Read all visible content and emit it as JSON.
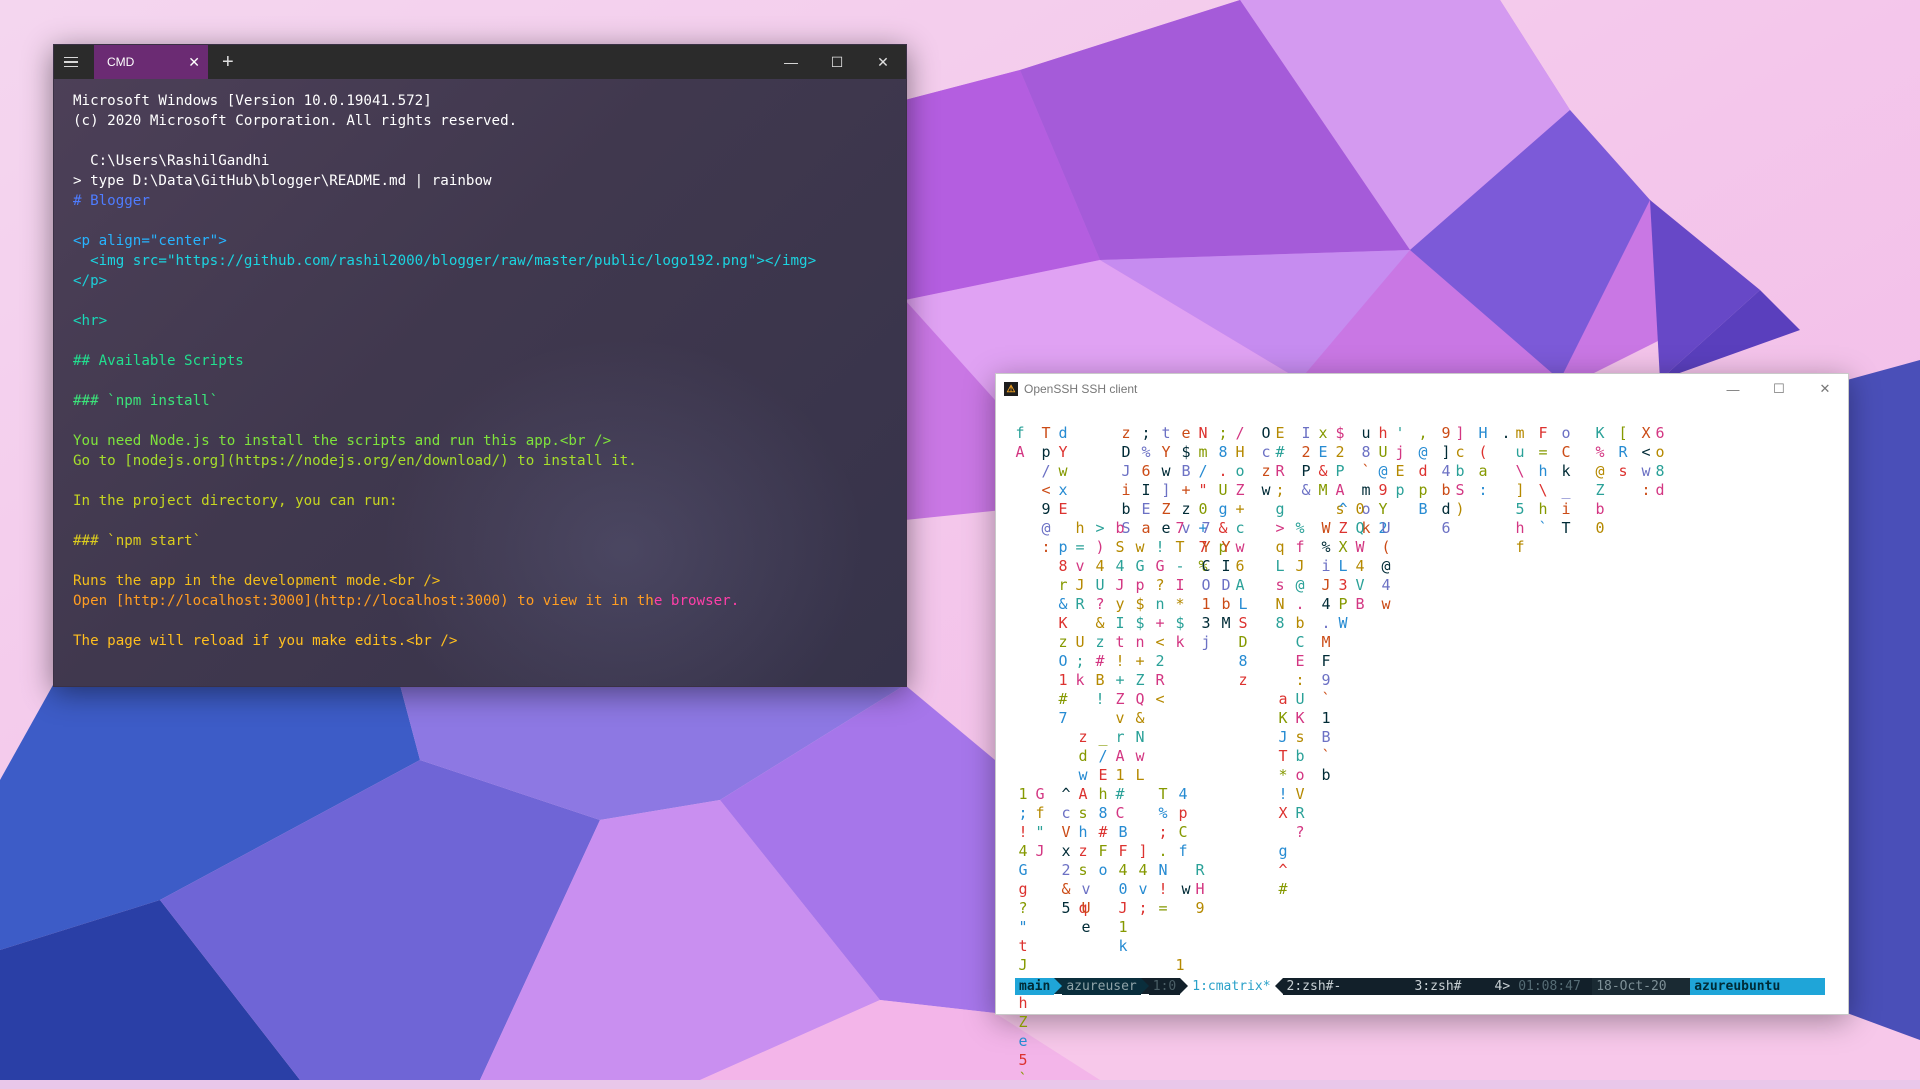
{
  "cmd_window": {
    "tab_title": "CMD",
    "tab_close": "✕",
    "new_tab": "+",
    "menu_icon": "hamburger-icon",
    "controls": {
      "minimize": "—",
      "maximize": "☐",
      "close": "✕"
    },
    "lines": [
      {
        "text": "Microsoft Windows [Version 10.0.19041.572]",
        "color": "#ffffff"
      },
      {
        "text": "(c) 2020 Microsoft Corporation. All rights reserved.",
        "color": "#ffffff"
      },
      {
        "text": "",
        "color": "#ffffff"
      },
      {
        "text": "  C:\\Users\\RashilGandhi",
        "color": "#ffffff"
      },
      {
        "text": "> type D:\\Data\\GitHub\\blogger\\README.md | rainbow",
        "color": "#ffffff"
      },
      {
        "text": "# Blogger",
        "color": "#4e7cff"
      },
      {
        "text": "",
        "color": "#ffffff"
      },
      {
        "text": "<p align=\"center\">",
        "color": "#27b4ff"
      },
      {
        "text": "  <img src=\"https://github.com/rashil2000/blogger/raw/master/public/logo192.png\"></img>",
        "color": "#1cd4e0"
      },
      {
        "text": "</p>",
        "color": "#1ccfd8"
      },
      {
        "text": "",
        "color": "#ffffff"
      },
      {
        "text": "<hr>",
        "color": "#19d8b8"
      },
      {
        "text": "",
        "color": "#ffffff"
      },
      {
        "text": "## Available Scripts",
        "color": "#22df8f"
      },
      {
        "text": "",
        "color": "#ffffff"
      },
      {
        "text": "### `npm install`",
        "color": "#3be47a"
      },
      {
        "text": "",
        "color": "#ffffff"
      },
      {
        "text": "You need Node.js to install the scripts and run this app.<br />",
        "color": "#7fe33c"
      },
      {
        "text": "Go to [nodejs.org](https://nodejs.org/en/download/) to install it.",
        "color": "#a6df2c"
      },
      {
        "text": "",
        "color": "#ffffff"
      },
      {
        "text": "In the project directory, you can run:",
        "color": "#c6d620"
      },
      {
        "text": "",
        "color": "#ffffff"
      },
      {
        "text": "### `npm start`",
        "color": "#dccd1e"
      },
      {
        "text": "",
        "color": "#ffffff"
      },
      {
        "text": "Runs the app in the development mode.<br />",
        "color": "#f2bd1c"
      },
      {
        "text": "Open [http://localhost:3000](http://localhost:3000) to view it in th",
        "color": "#ff9d22",
        "tail": "e browser.",
        "tail_color": "#ff3fa8"
      },
      {
        "text": "",
        "color": "#ffffff"
      },
      {
        "text": "The page will reload if you make edits.<br />",
        "color": "#ffbf1f"
      }
    ]
  },
  "ssh_window": {
    "title": "OpenSSH SSH client",
    "app_icon": "ssh-app-icon",
    "controls": {
      "minimize": "—",
      "maximize": "☐",
      "close": "✕"
    },
    "matrix_colors": [
      "#2aa198",
      "#268bd2",
      "#6c71c4",
      "#d33682",
      "#dc322f",
      "#cb4b16",
      "#b58900",
      "#859900",
      "#002b36"
    ],
    "matrix_columns": [
      {
        "col": 0,
        "start": 0,
        "chars": "fA"
      },
      {
        "col": 0,
        "start": 19,
        "chars": "1;!4Gg?\"tJ0hZe5`"
      },
      {
        "col": 1,
        "start": 0,
        "chars": "Tp/<9@:"
      },
      {
        "col": 1,
        "start": 19,
        "chars": "Gf\"J"
      },
      {
        "col": 2,
        "start": 0,
        "chars": "dYwxE p8r&KzO1#7"
      },
      {
        "col": 2,
        "start": 19,
        "chars": "^cVx2&5"
      },
      {
        "col": 3,
        "start": 5,
        "chars": "h=vJR U;k"
      },
      {
        "col": 3,
        "start": 16,
        "chars": "zdwAshzs q"
      },
      {
        "col": 3,
        "start": 24,
        "chars": "vUe"
      },
      {
        "col": 4,
        "start": 5,
        "chars": ">)4U?&z#B!"
      },
      {
        "col": 4,
        "start": 16,
        "chars": "_/Eh8#Fo"
      },
      {
        "col": 5,
        "start": 0,
        "chars": "zDJibS"
      },
      {
        "col": 5,
        "start": 5,
        "chars": "bS4JyIt!+ZvrA1#C"
      },
      {
        "col": 5,
        "start": 21,
        "chars": "BF40J1k"
      },
      {
        "col": 6,
        "start": 0,
        "chars": ";%6IEa"
      },
      {
        "col": 6,
        "start": 6,
        "chars": "wGp$$n+ZQ&NwL"
      },
      {
        "col": 6,
        "start": 22,
        "chars": "]4v;"
      },
      {
        "col": 7,
        "start": 0,
        "chars": "tYw]Ze"
      },
      {
        "col": 7,
        "start": 6,
        "chars": "!G?n+<2R<"
      },
      {
        "col": 7,
        "start": 19,
        "chars": "T%;.N!="
      },
      {
        "col": 8,
        "start": 0,
        "chars": "e$B+zv"
      },
      {
        "col": 8,
        "start": 5,
        "chars": "7T-I*$k"
      },
      {
        "col": 8,
        "start": 19,
        "chars": "4pCf"
      },
      {
        "col": 8,
        "start": 24,
        "chars": "w"
      },
      {
        "col": 8,
        "start": 28,
        "chars": "1"
      },
      {
        "col": 9,
        "start": 0,
        "chars": "Nm/\"0+7%"
      },
      {
        "col": 9,
        "start": 5,
        "chars": "7YCO13j"
      },
      {
        "col": 9,
        "start": 23,
        "chars": "RH9"
      },
      {
        "col": 10,
        "start": 0,
        "chars": ";8.Ug&p"
      },
      {
        "col": 10,
        "start": 6,
        "chars": "YIDbM"
      },
      {
        "col": 11,
        "start": 0,
        "chars": "/HoZ+cw6A"
      },
      {
        "col": 11,
        "start": 9,
        "chars": "LSD8z"
      },
      {
        "col": 12,
        "start": 0,
        "chars": "Oczw"
      },
      {
        "col": 13,
        "start": 0,
        "chars": "E#R;g>qLsN8"
      },
      {
        "col": 13,
        "start": 14,
        "chars": "aKJT*!X g^#"
      },
      {
        "col": 14,
        "start": 0,
        "chars": "I2P&"
      },
      {
        "col": 14,
        "start": 5,
        "chars": "%fJ@.bCE:UKsboVR?"
      },
      {
        "col": 15,
        "start": 0,
        "chars": "xE&M"
      },
      {
        "col": 15,
        "start": 5,
        "chars": "W%iJ4.MF9`1B`b"
      },
      {
        "col": 16,
        "start": 0,
        "chars": "$2PAs"
      },
      {
        "col": 16,
        "start": 4,
        "chars": "^ZXL3PW"
      },
      {
        "col": 17,
        "start": 0,
        "chars": "u8`mok"
      },
      {
        "col": 17,
        "start": 4,
        "chars": "0QW4VB"
      },
      {
        "col": 18,
        "start": 0,
        "chars": "hU@9Y2"
      },
      {
        "col": 18,
        "start": 5,
        "chars": "U(@4w"
      },
      {
        "col": 19,
        "start": 0,
        "chars": "'jEp"
      },
      {
        "col": 20,
        "start": 0,
        "chars": ",@dpB"
      },
      {
        "col": 21,
        "start": 0,
        "chars": "9]4bd6"
      },
      {
        "col": 22,
        "start": 0,
        "chars": "]cbS)"
      },
      {
        "col": 23,
        "start": 0,
        "chars": "H(a:"
      },
      {
        "col": 24,
        "start": 0,
        "chars": "."
      },
      {
        "col": 25,
        "start": 0,
        "chars": "mu\\]5hf"
      },
      {
        "col": 26,
        "start": 0,
        "chars": "F=h\\h`"
      },
      {
        "col": 27,
        "start": 0,
        "chars": "oCk_iT"
      },
      {
        "col": 29,
        "start": 0,
        "chars": "K%@Zb0"
      },
      {
        "col": 30,
        "start": 0,
        "chars": "[Rs"
      },
      {
        "col": 31,
        "start": 0,
        "chars": "X<w:"
      },
      {
        "col": 32,
        "start": 0,
        "chars": "6o8d"
      }
    ],
    "status": {
      "session": "main",
      "user": "azureuser",
      "pane": "1:0",
      "win1": "1:cmatrix*",
      "win2": "2:zsh#-",
      "win3": "3:zsh#",
      "count": "4>",
      "time": "01:08:47",
      "date": "18-Oct-20",
      "host": "azureubuntu"
    }
  }
}
